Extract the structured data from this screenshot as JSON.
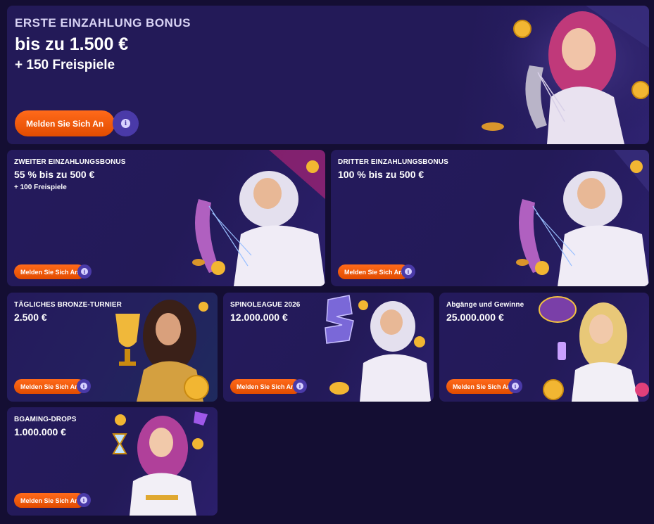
{
  "colors": {
    "background": "#140e33",
    "card": "#231a58",
    "button": "#f05a0a",
    "info": "#4a3aa8"
  },
  "common": {
    "info_symbol": "i"
  },
  "hero": {
    "eyebrow": "ERSTE EINZAHLUNG BONUS",
    "amount": "bis zu 1.500 €",
    "extra": "+ 150 Freispiele",
    "button": "Melden Sie Sich An",
    "art": "muse-with-harp-illustration"
  },
  "cards": [
    {
      "eyebrow": "ZWEITER EINZAHLUNGSBONUS",
      "amount": "55 % bis zu 500 €",
      "extra": "+ 100 Freispiele",
      "button": "Melden Sie Sich An",
      "art": "zeus-with-harp-illustration"
    },
    {
      "eyebrow": "DRITTER EINZAHLUNGSBONUS",
      "amount": "100 % bis zu 500 €",
      "extra": "",
      "button": "Melden Sie Sich An",
      "art": "zeus-with-harp-illustration"
    },
    {
      "eyebrow": "TÄGLICHES BRONZE-TURNIER",
      "amount": "2.500 €",
      "extra": "",
      "button": "Melden Sie Sich An",
      "art": "woman-with-trophy-illustration"
    },
    {
      "eyebrow": "SPINOLEAGUE 2026",
      "amount": "12.000.000 €",
      "extra": "",
      "button": "Melden Sie Sich An",
      "art": "zeus-with-s-emblem-illustration"
    },
    {
      "eyebrow": "Abgänge und Gewinne",
      "amount": "25.000.000 €",
      "extra": "",
      "button": "Melden Sie Sich An",
      "art": "goddess-drops-and-wins-illustration"
    },
    {
      "eyebrow": "BGAMING-DROPS",
      "amount": "1.000.000 €",
      "extra": "",
      "button": "Melden Sie Sich An",
      "art": "goddess-with-hourglass-illustration"
    }
  ]
}
